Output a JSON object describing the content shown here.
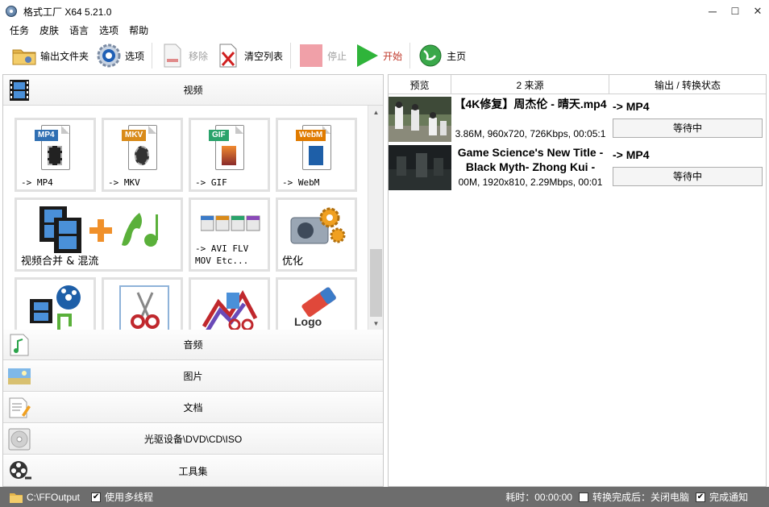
{
  "window": {
    "title": "格式工厂 X64 5.21.0",
    "controls": {
      "minimize": "─",
      "maximize": "☐",
      "close": "✕"
    }
  },
  "menu": [
    "任务",
    "皮肤",
    "语言",
    "选项",
    "帮助"
  ],
  "toolbar": {
    "output_folder": "输出文件夹",
    "options": "选项",
    "remove": "移除",
    "clear_list": "清空列表",
    "stop": "停止",
    "start": "开始",
    "home": "主页"
  },
  "categories": {
    "video": "视频",
    "audio": "音频",
    "image": "图片",
    "document": "文档",
    "optical": "光驱设备\\DVD\\CD\\ISO",
    "tools": "工具集"
  },
  "video_tiles": [
    {
      "badge": "MP4",
      "label": "-> MP4",
      "color": "#2f6fb3"
    },
    {
      "badge": "MKV",
      "label": "-> MKV",
      "color": "#d98b1a"
    },
    {
      "badge": "GIF",
      "label": "-> GIF",
      "color": "#2aa36b"
    },
    {
      "badge": "WebM",
      "label": "-> WebM",
      "color": "#e07b00"
    },
    {
      "label": "视频合并 & 混流"
    },
    {
      "label": "-> AVI FLV\nMOV Etc..."
    },
    {
      "label": "优化"
    },
    {
      "label": ""
    },
    {
      "label": ""
    },
    {
      "label": ""
    },
    {
      "label": "Logo"
    }
  ],
  "table": {
    "headers": [
      "预览",
      "2 来源",
      "输出 / 转换状态"
    ],
    "rows": [
      {
        "title": "【4K修复】周杰伦 - 晴天.mp4",
        "meta": "3.86M, 960x720, 726Kbps, 00:05:1",
        "output": "-> MP4",
        "status": "等待中"
      },
      {
        "title": "Game Science's New Title - Black Myth- Zhong Kui -",
        "meta": "00M, 1920x810, 2.29Mbps, 00:01",
        "output": "-> MP4",
        "status": "等待中"
      }
    ]
  },
  "statusbar": {
    "output_path": "C:\\FFOutput",
    "multithread": "使用多线程",
    "elapsed": "耗时：00:00:00",
    "after_done": "转换完成后：关闭电脑",
    "notify": "完成通知",
    "multithread_checked": "✔",
    "after_done_checked": "",
    "notify_checked": "✔"
  }
}
